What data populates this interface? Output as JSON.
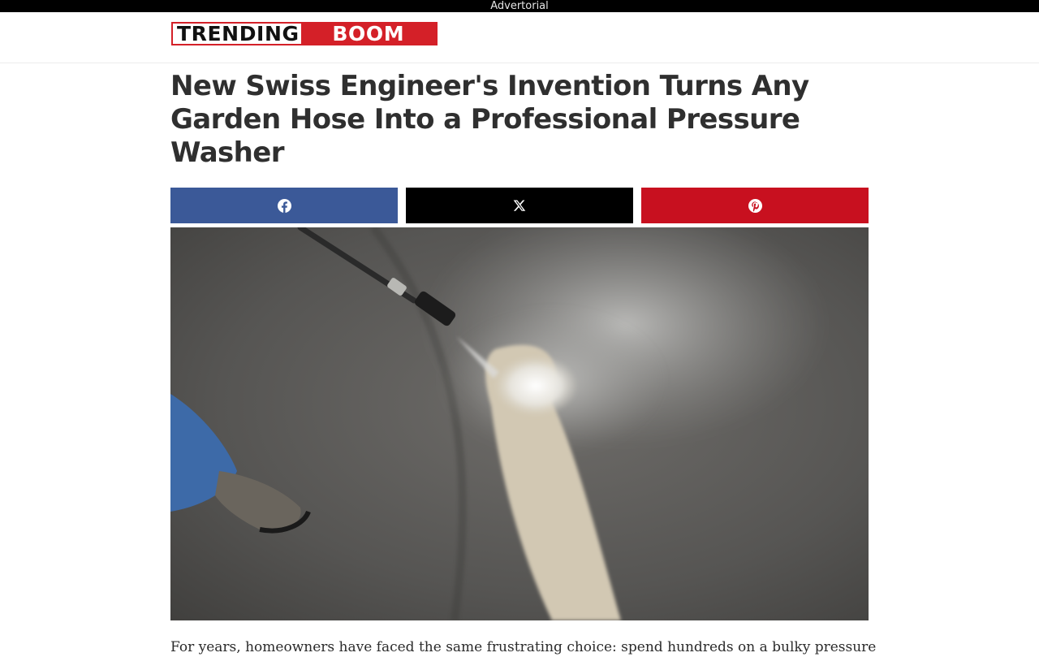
{
  "ad_label": "Advertorial",
  "logo": {
    "part1": "TRENDING",
    "part2": "BOOM"
  },
  "article": {
    "title": "New Swiss Engineer's Invention Turns Any Garden Hose Into a Professional Pressure Washer",
    "intro": "For years, homeowners have faced the same frustrating choice: spend hundreds on a bulky pressure"
  },
  "share": {
    "facebook_icon": "facebook-icon",
    "x_icon": "x-icon",
    "pinterest_icon": "pinterest-icon"
  },
  "colors": {
    "brand_red": "#d42028",
    "facebook": "#3b5998",
    "x": "#000000",
    "pinterest": "#c8101f"
  }
}
